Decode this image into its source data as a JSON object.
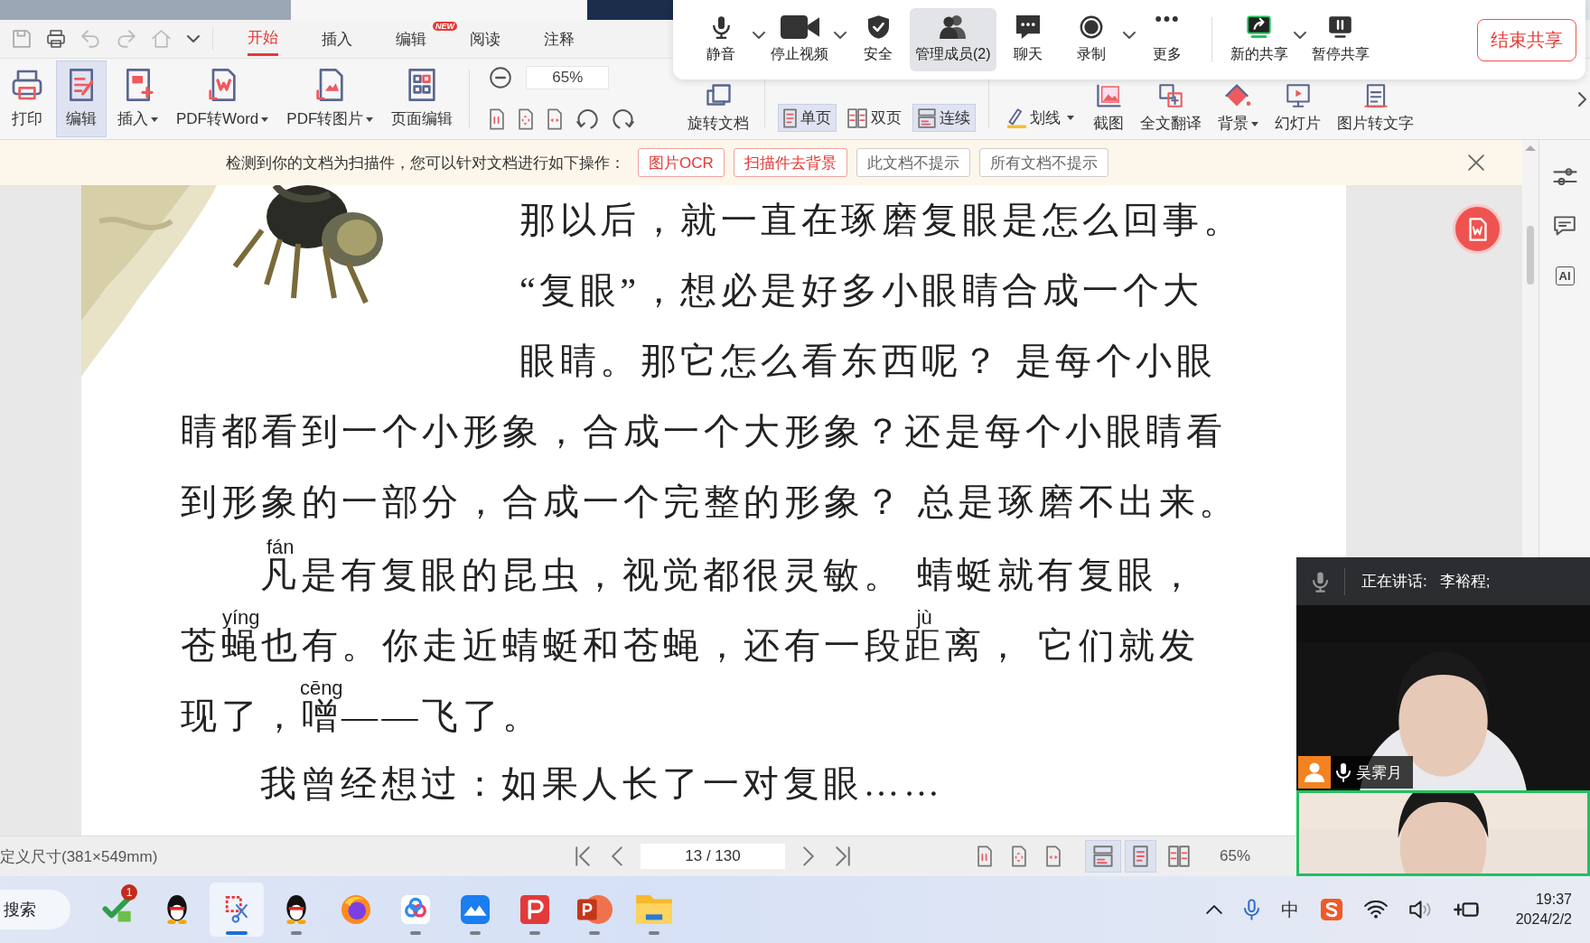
{
  "tabs": [
    {
      "label": "开始",
      "selected": true
    },
    {
      "label": "插入",
      "selected": false
    },
    {
      "label": "编辑",
      "selected": false,
      "badge": "NEW"
    },
    {
      "label": "阅读",
      "selected": false
    },
    {
      "label": "注释",
      "selected": false
    }
  ],
  "ribbon": {
    "buttons": [
      {
        "label": "打印",
        "selected": false
      },
      {
        "label": "编辑",
        "selected": true
      },
      {
        "label": "插入",
        "selected": false,
        "dropdown": true
      },
      {
        "label": "PDF转Word",
        "selected": false,
        "dropdown": true
      },
      {
        "label": "PDF转图片",
        "selected": false,
        "dropdown": true
      },
      {
        "label": "页面编辑",
        "selected": false
      }
    ],
    "zoom": "65%",
    "rotate_label": "旋转文档",
    "view_modes": [
      {
        "label": "单页",
        "selected": true
      },
      {
        "label": "双页",
        "selected": false
      },
      {
        "label": "连续",
        "selected": true
      }
    ],
    "strike": {
      "label": "划线",
      "dropdown": true
    },
    "tools": [
      {
        "label": "截图"
      },
      {
        "label": "全文翻译"
      },
      {
        "label": "背景",
        "dropdown": true
      },
      {
        "label": "幻灯片"
      },
      {
        "label": "图片转文字"
      }
    ]
  },
  "notice": {
    "text": "检测到你的文档为扫描件，您可以针对文档进行如下操作：",
    "actions": [
      {
        "label": "图片OCR",
        "kind": "primary"
      },
      {
        "label": "扫描件去背景",
        "kind": "primary"
      },
      {
        "label": "此文档不提示",
        "kind": "plain"
      },
      {
        "label": "所有文档不提示",
        "kind": "plain"
      }
    ]
  },
  "document": {
    "figure": {
      "kind": "picture"
    },
    "picture_lines": [
      {
        "indent": false,
        "segments": [
          {
            "text": "那以后，就一直在琢磨复眼是怎么回事。"
          }
        ]
      },
      {
        "indent": false,
        "segments": [
          {
            "text": "“复眼”，想必是好多小眼睛合成一个大"
          }
        ]
      },
      {
        "indent": false,
        "segments": [
          {
            "text": "眼睛。那它怎么看东西呢？ 是每个小眼"
          }
        ]
      }
    ],
    "lines": [
      {
        "indent": false,
        "segments": [
          {
            "text": "睛都看到一个小形象，合成一个大形象？还是每个小眼睛看"
          }
        ]
      },
      {
        "indent": false,
        "segments": [
          {
            "text": "到形象的一部分，合成一个完整的形象？ 总是琢磨不出来。"
          }
        ]
      },
      {
        "indent": true,
        "segments": [
          {
            "text": "凡",
            "ruby": "fán"
          },
          {
            "text": "是有复眼的昆虫，视觉都很灵敏。 蜻蜓就有复眼，"
          }
        ]
      },
      {
        "indent": false,
        "segments": [
          {
            "text": "苍"
          },
          {
            "text": "蝇",
            "ruby": "yíng"
          },
          {
            "text": "也有。你走近蜻蜓和苍蝇，还有一段"
          },
          {
            "text": "距",
            "ruby": "jù"
          },
          {
            "text": "离， 它们就发"
          }
        ]
      },
      {
        "indent": false,
        "segments": [
          {
            "text": "现了，"
          },
          {
            "text": "噌",
            "ruby": "cēng"
          },
          {
            "text": "——飞了。"
          }
        ]
      },
      {
        "indent": true,
        "segments": [
          {
            "text": "我曾经想过：如果人长了一对复眼……"
          }
        ]
      }
    ]
  },
  "sidebar": {
    "ai_label": "AI"
  },
  "status_bar": {
    "page_size": "定义尺寸(381×549mm)",
    "page": "13 / 130",
    "zoom": "65%",
    "view_buttons": [
      {
        "selected": false
      },
      {
        "selected": false
      },
      {
        "selected": false
      },
      {
        "selected": true
      },
      {
        "selected": true
      },
      {
        "selected": false
      }
    ]
  },
  "meeting_toolbar": {
    "items": [
      {
        "label": "静音",
        "selected": false,
        "menu": true
      },
      {
        "label": "停止视频",
        "selected": false,
        "menu": true
      },
      {
        "label": "安全",
        "selected": false
      },
      {
        "label": "管理成员(2)",
        "selected": true
      },
      {
        "label": "聊天",
        "selected": false
      },
      {
        "label": "录制",
        "selected": false,
        "menu": true
      },
      {
        "label": "更多",
        "selected": false
      }
    ],
    "share_items": [
      {
        "label": "新的共享",
        "selected": false,
        "menu": true
      },
      {
        "label": "暂停共享",
        "selected": false
      }
    ],
    "end_button": "结束共享"
  },
  "video_panel": {
    "speaking_label": "正在讲话:",
    "speaker": "李裕程;",
    "videos": [
      {
        "kind": "picture",
        "name": "吴霁月",
        "highlighted": false
      },
      {
        "kind": "picture",
        "highlighted": true
      }
    ]
  },
  "taskbar": {
    "search": "搜索",
    "apps": [
      {
        "badge": "1",
        "running": false,
        "active": false
      },
      {
        "running": false,
        "active": false
      },
      {
        "running": true,
        "active": true
      },
      {
        "running": true,
        "active": false
      },
      {
        "running": false,
        "active": false
      },
      {
        "running": true,
        "active": false
      },
      {
        "running": true,
        "active": false
      },
      {
        "running": true,
        "active": false
      },
      {
        "running": true,
        "active": false
      },
      {
        "running": true,
        "active": false
      }
    ],
    "input_method": "中",
    "clock": {
      "time": "19:37",
      "date": "2024/2/2"
    }
  }
}
